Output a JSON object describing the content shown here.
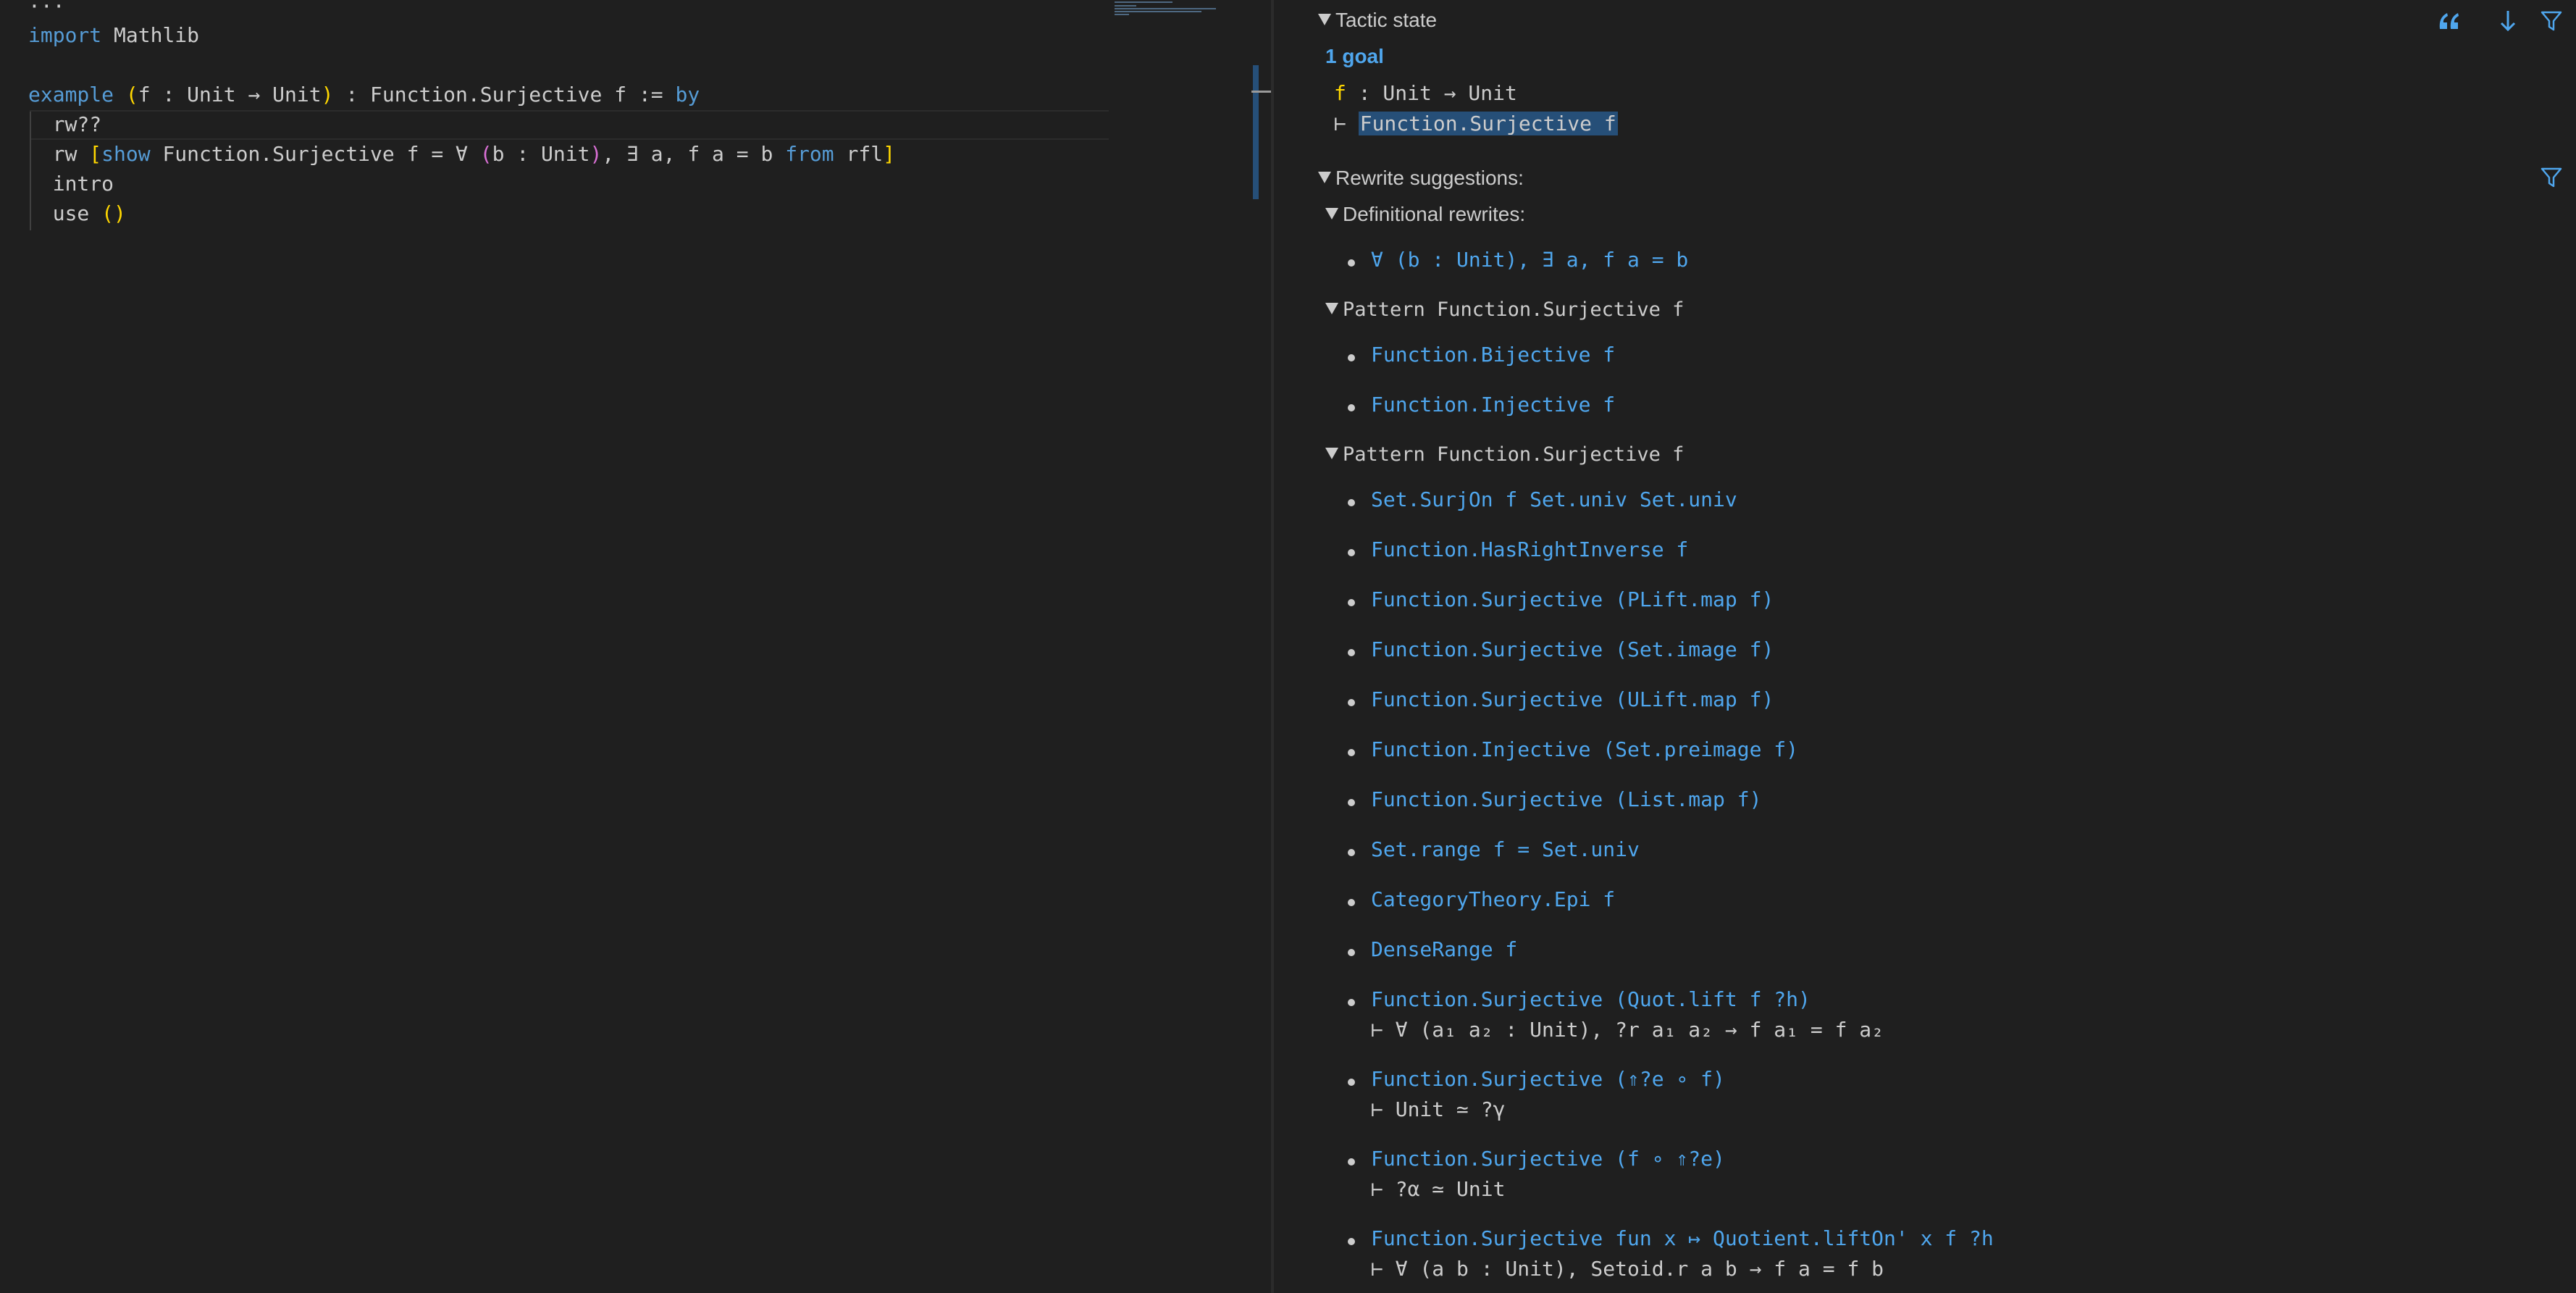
{
  "editor": {
    "lines": [
      {
        "name": "code-line-ellipsis",
        "parts": [
          {
            "t": "···",
            "c": ""
          }
        ]
      },
      {
        "name": "code-line-import",
        "parts": [
          {
            "t": "import",
            "c": "kw"
          },
          {
            "t": " Mathlib",
            "c": ""
          }
        ]
      },
      {
        "name": "code-line-blank",
        "parts": []
      },
      {
        "name": "code-line-example",
        "parts": [
          {
            "t": "example",
            "c": "kw"
          },
          {
            "t": " ",
            "c": ""
          },
          {
            "t": "(",
            "c": "br1"
          },
          {
            "t": "f : Unit → Unit",
            "c": ""
          },
          {
            "t": ")",
            "c": "br1"
          },
          {
            "t": " : Function.Surjective f := ",
            "c": ""
          },
          {
            "t": "by",
            "c": "kw"
          }
        ]
      },
      {
        "name": "code-line-rw-suggest",
        "parts": [
          {
            "t": "  rw??",
            "c": ""
          }
        ]
      },
      {
        "name": "code-line-rw-show",
        "parts": [
          {
            "t": "  rw ",
            "c": ""
          },
          {
            "t": "[",
            "c": "br1"
          },
          {
            "t": "show",
            "c": "kw"
          },
          {
            "t": " Function.Surjective f = ∀ ",
            "c": ""
          },
          {
            "t": "(",
            "c": "br2"
          },
          {
            "t": "b : Unit",
            "c": ""
          },
          {
            "t": ")",
            "c": "br2"
          },
          {
            "t": ", ∃ a, f a = b ",
            "c": ""
          },
          {
            "t": "from",
            "c": "kw"
          },
          {
            "t": " rfl",
            "c": ""
          },
          {
            "t": "]",
            "c": "br1"
          }
        ]
      },
      {
        "name": "code-line-intro",
        "parts": [
          {
            "t": "  intro",
            "c": ""
          }
        ]
      },
      {
        "name": "code-line-use",
        "parts": [
          {
            "t": "  use ",
            "c": ""
          },
          {
            "t": "()",
            "c": "br1"
          }
        ]
      }
    ]
  },
  "infoview": {
    "tactic_state_label": "Tactic state",
    "goal_count": "1 goal",
    "hyp_name": "f",
    "hyp_type": " : Unit → Unit",
    "turnstile": "⊢ ",
    "goal": "Function.Surjective f",
    "rewrite_label": "Rewrite suggestions:",
    "sections": [
      {
        "title": "Definitional rewrites:",
        "mono": false,
        "items": [
          {
            "text": "∀ (b : Unit), ∃ a, f a = b"
          }
        ]
      },
      {
        "title": "Pattern Function.Surjective f",
        "mono": true,
        "items": [
          {
            "text": "Function.Bijective f"
          },
          {
            "text": "Function.Injective f"
          }
        ]
      },
      {
        "title": "Pattern Function.Surjective f",
        "mono": true,
        "items": [
          {
            "text": "Set.SurjOn f Set.univ Set.univ"
          },
          {
            "text": "Function.HasRightInverse f"
          },
          {
            "text": "Function.Surjective (PLift.map f)"
          },
          {
            "text": "Function.Surjective (Set.image f)"
          },
          {
            "text": "Function.Surjective (ULift.map f)"
          },
          {
            "text": "Function.Injective (Set.preimage f)"
          },
          {
            "text": "Function.Surjective (List.map f)"
          },
          {
            "text": "Set.range f = Set.univ"
          },
          {
            "text": "CategoryTheory.Epi f"
          },
          {
            "text": "DenseRange f"
          },
          {
            "text": "Function.Surjective (Quot.lift f ?h)",
            "side": "⊢ ∀ (a₁ a₂ : Unit), ?r a₁ a₂ → f a₁ = f a₂"
          },
          {
            "text": "Function.Surjective (⇑?e ∘ f)",
            "side": "⊢ Unit ≃ ?γ"
          },
          {
            "text": "Function.Surjective (f ∘ ⇑?e)",
            "side": "⊢ ?α ≃ Unit"
          },
          {
            "text": "Function.Surjective fun x ↦ Quotient.liftOn' x f ?h",
            "side": "⊢ ∀ (a b : Unit), Setoid.r a b → f a = f b"
          }
        ]
      }
    ],
    "icons": {
      "copy": "quote-icon",
      "scroll": "arrow-down-icon",
      "filter": "filter-icon"
    },
    "colors": {
      "accent": "#4fa6ed",
      "goal_highlight": "#264f78",
      "hypothesis": "#ffd700"
    }
  }
}
